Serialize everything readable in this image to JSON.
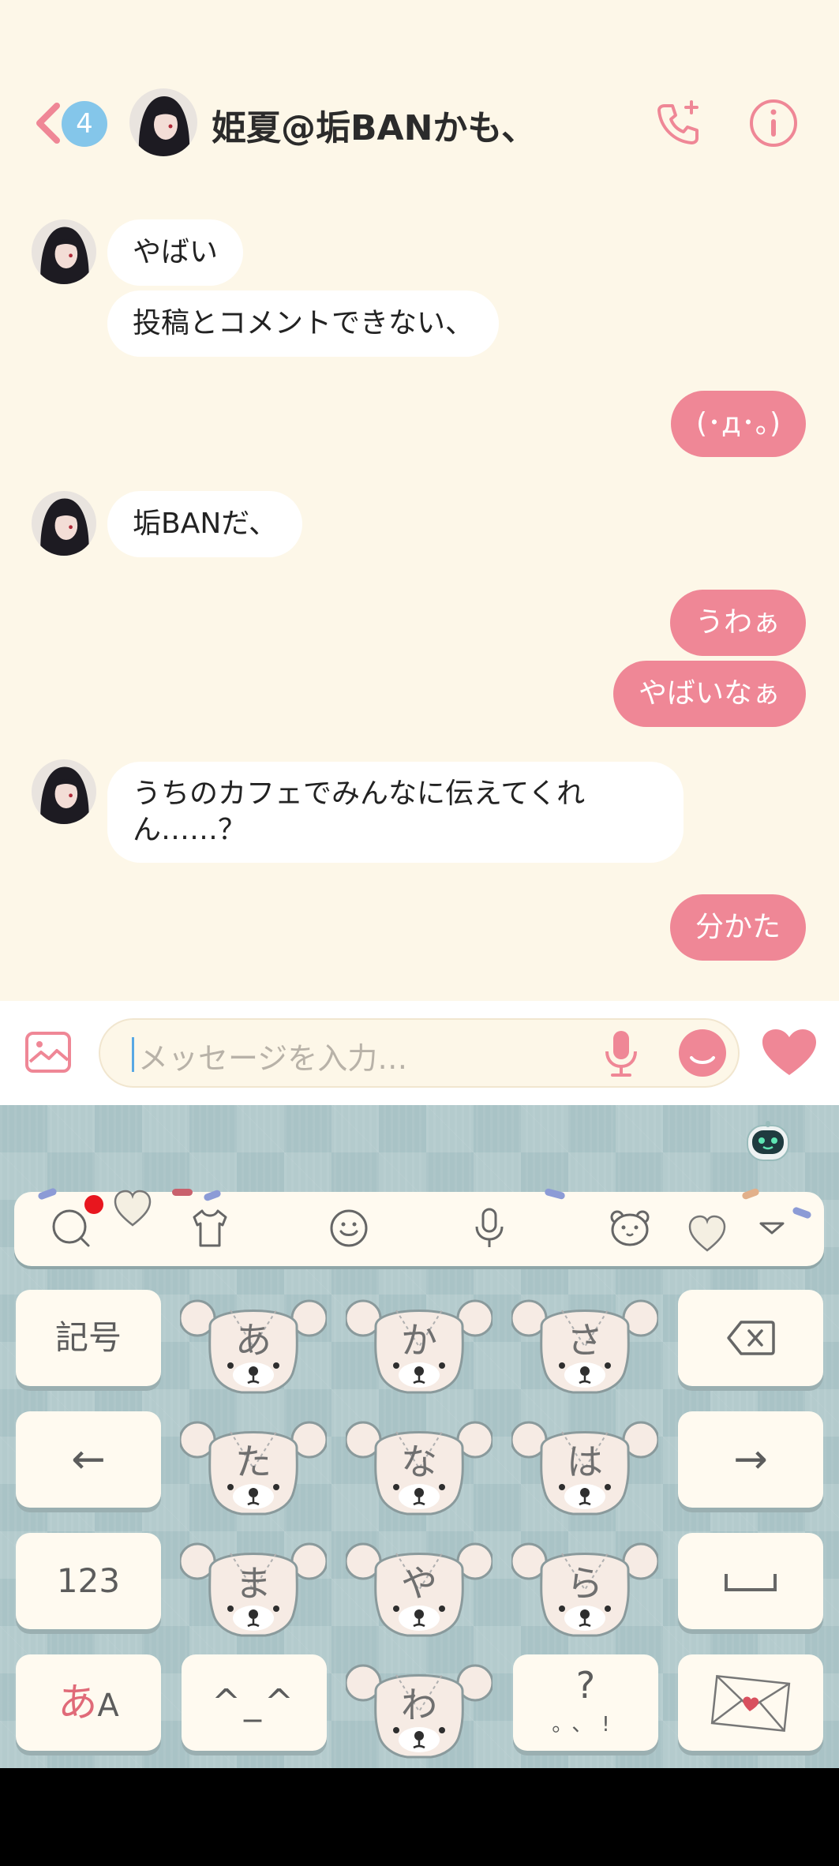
{
  "header": {
    "unread_count": "4",
    "title": "姫夏@垢BANかも、"
  },
  "messages": [
    {
      "side": "in",
      "text": "やばい"
    },
    {
      "side": "in",
      "text": "投稿とコメントできない、"
    },
    {
      "side": "out",
      "text": "(･д･｡)"
    },
    {
      "side": "in",
      "text": "垢BANだ、"
    },
    {
      "side": "out",
      "text": "うわぁ"
    },
    {
      "side": "out",
      "text": "やばいなぁ"
    },
    {
      "side": "in",
      "text": "うちのカフェでみんなに伝えてくれん……？"
    },
    {
      "side": "out",
      "text": "分かた"
    }
  ],
  "input": {
    "placeholder": "メッセージを入力…"
  },
  "keyboard": {
    "keys": {
      "symbols": "記号",
      "numbers": "123",
      "mode_a": "あ",
      "mode_b": "A",
      "kaomoji": "^_^",
      "punct_q": "?",
      "punct_marks": "。、!",
      "left_arrow": "←",
      "right_arrow": "→"
    },
    "kana": [
      "あ",
      "か",
      "さ",
      "た",
      "な",
      "は",
      "ま",
      "や",
      "ら",
      "わ"
    ]
  },
  "colors": {
    "accent_pink": "#ef8796",
    "badge_blue": "#84c6ea",
    "chat_bg": "#fdf7e8",
    "keyboard_bg": "#a9c3c6"
  }
}
